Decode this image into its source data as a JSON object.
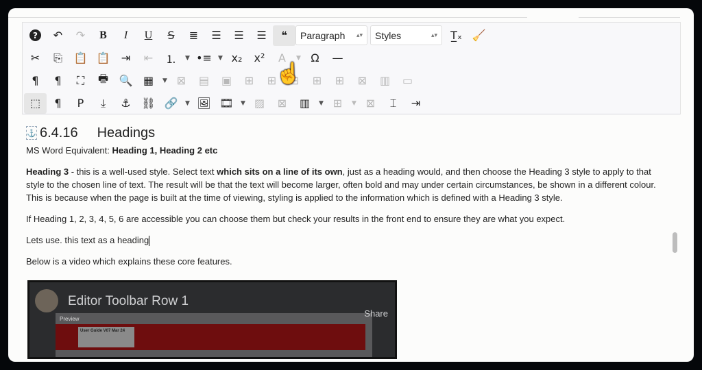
{
  "toolbar": {
    "rows": [
      [
        {
          "n": "help-icon",
          "g": "❓"
        },
        {
          "n": "undo-icon",
          "g": "↶"
        },
        {
          "n": "redo-icon",
          "g": "↷",
          "d": true
        },
        {
          "n": "bold-icon",
          "g": "B"
        },
        {
          "n": "italic-icon",
          "g": "I"
        },
        {
          "n": "underline-icon",
          "g": "U"
        },
        {
          "n": "strikethrough-icon",
          "g": "S"
        },
        {
          "n": "justify-icon",
          "g": "≣"
        },
        {
          "n": "align-center-icon",
          "g": "☰"
        },
        {
          "n": "align-left-icon",
          "g": "☰"
        },
        {
          "n": "align-right-icon",
          "g": "☰"
        },
        {
          "n": "blockquote-icon",
          "g": "❝",
          "on": true
        },
        {
          "sel": "paragraph"
        },
        {
          "sel": "styles"
        },
        {
          "n": "clear-formatting-icon",
          "g": "T̲ₓ"
        },
        {
          "n": "clean-up-icon",
          "g": "🧹"
        }
      ],
      [
        {
          "n": "cut-icon",
          "g": "✂"
        },
        {
          "n": "copy-icon",
          "g": "⎘"
        },
        {
          "n": "paste-icon",
          "g": "📋"
        },
        {
          "n": "paste-as-text-icon",
          "g": "📋"
        },
        {
          "n": "indent-icon",
          "g": "⇥"
        },
        {
          "n": "outdent-icon",
          "g": "⇤",
          "d": true
        },
        {
          "n": "numbered-list-icon",
          "g": "⒈"
        },
        {
          "a": 1
        },
        {
          "n": "bullet-list-icon",
          "g": "•≡"
        },
        {
          "a": 1
        },
        {
          "n": "subscript-icon",
          "g": "x₂"
        },
        {
          "n": "superscript-icon",
          "g": "x²"
        },
        {
          "n": "text-color-icon",
          "g": "A",
          "d": true
        },
        {
          "a": 1,
          "d": true
        },
        {
          "n": "special-character-icon",
          "g": "Ω"
        },
        {
          "n": "horizontal-line-icon",
          "g": "—"
        }
      ],
      [
        {
          "n": "ltr-icon",
          "g": "¶"
        },
        {
          "n": "rtl-icon",
          "g": "¶"
        },
        {
          "n": "fullscreen-icon",
          "g": "⛶"
        },
        {
          "n": "print-icon",
          "g": "🖶"
        },
        {
          "n": "search-icon",
          "g": "🔍"
        },
        {
          "n": "table-icon",
          "g": "▦"
        },
        {
          "a": 1
        },
        {
          "n": "delete-table-icon",
          "g": "⊠",
          "d": true
        },
        {
          "n": "row-props-icon",
          "g": "▤",
          "d": true
        },
        {
          "n": "cell-props-icon",
          "g": "▣",
          "d": true
        },
        {
          "n": "insert-row-before-icon",
          "g": "⊞",
          "d": true
        },
        {
          "n": "insert-row-after-icon",
          "g": "⊞",
          "d": true
        },
        {
          "n": "delete-row-icon",
          "g": "⊟",
          "d": true
        },
        {
          "n": "insert-col-before-icon",
          "g": "⊞",
          "d": true
        },
        {
          "n": "insert-col-after-icon",
          "g": "⊞",
          "d": true
        },
        {
          "n": "delete-col-icon",
          "g": "⊠",
          "d": true
        },
        {
          "n": "split-cells-icon",
          "g": "▥",
          "d": true
        },
        {
          "n": "merge-cells-icon",
          "g": "▭",
          "d": true
        }
      ],
      [
        {
          "n": "visual-blocks-icon",
          "g": "⬚",
          "on": true
        },
        {
          "n": "visual-chars-icon",
          "g": "¶"
        },
        {
          "n": "paragraph-block-icon",
          "g": "P"
        },
        {
          "n": "insert-icon",
          "g": "⤓"
        },
        {
          "n": "anchor-icon",
          "g": "⚓"
        },
        {
          "n": "unlink-icon",
          "g": "⛓"
        },
        {
          "n": "link-icon",
          "g": "🔗"
        },
        {
          "a": 1
        },
        {
          "n": "image-icon",
          "g": "🖼"
        },
        {
          "n": "media-icon",
          "g": "🎞"
        },
        {
          "a": 1
        },
        {
          "n": "image-edit-icon",
          "g": "▨",
          "d": true
        },
        {
          "n": "image-remove-icon",
          "g": "⊠",
          "d": true
        },
        {
          "n": "columns-icon",
          "g": "▥"
        },
        {
          "a": 1
        },
        {
          "n": "insert-column-icon",
          "g": "⊞",
          "d": true
        },
        {
          "a": 1,
          "d": true
        },
        {
          "n": "delete-column-icon",
          "g": "⊠",
          "d": true
        },
        {
          "n": "page-break-icon",
          "g": "⌶"
        },
        {
          "n": "template-icon",
          "g": "⇥"
        }
      ]
    ],
    "paragraph_select": "Paragraph",
    "styles_select": "Styles"
  },
  "content": {
    "heading_number": "6.4.16",
    "heading_text": "Headings",
    "ms_word_label": "MS Word Equivalent: ",
    "ms_word_value": "Heading 1, Heading 2 etc",
    "p1_bold1": "Heading 3",
    "p1_text1": " - this is a well-used style. Select text ",
    "p1_bold2": "which sits on a line of its own",
    "p1_text2": ", just as a heading would, and then choose the Heading 3 style to apply to that style to the chosen line of text. The result will be that the text will become larger, often bold and may under certain circumstances, be shown in a different colour. This is because when the page is built at the time of viewing, styling is applied to the information which is defined with a Heading 3 style.",
    "p2": "If Heading 1, 2, 3, 4, 5, 6 are accessible you can choose them but check your results in the front end to ensure they are what you expect.",
    "p3": "Lets use. this text as a heading",
    "p4": "Below is a video which explains these core features."
  },
  "video": {
    "title": "Editor Toolbar Row 1",
    "share": "Share",
    "preview_label": "Preview",
    "card_title": "User Guide V07 Mar 24"
  }
}
